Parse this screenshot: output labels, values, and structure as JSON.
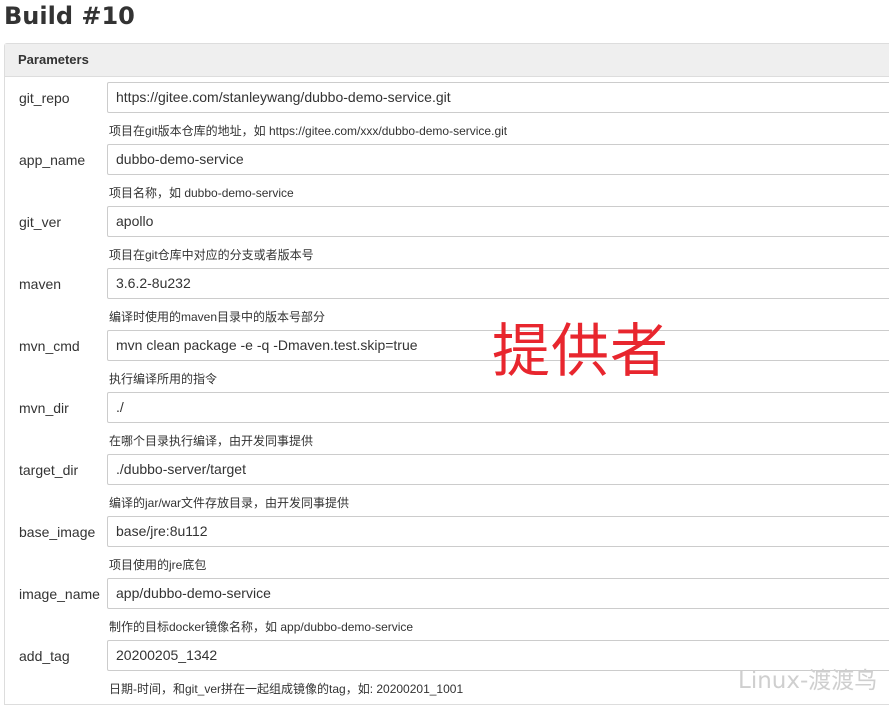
{
  "page": {
    "title": "Build #10"
  },
  "panel": {
    "header": "Parameters"
  },
  "params": [
    {
      "name": "git_repo",
      "value": "https://gitee.com/stanleywang/dubbo-demo-service.git",
      "description": "项目在git版本仓库的地址，如 https://gitee.com/xxx/dubbo-demo-service.git"
    },
    {
      "name": "app_name",
      "value": "dubbo-demo-service",
      "description": "项目名称，如 dubbo-demo-service"
    },
    {
      "name": "git_ver",
      "value": "apollo",
      "description": "项目在git仓库中对应的分支或者版本号"
    },
    {
      "name": "maven",
      "value": "3.6.2-8u232",
      "description": "编译时使用的maven目录中的版本号部分"
    },
    {
      "name": "mvn_cmd",
      "value": "mvn clean package -e -q -Dmaven.test.skip=true",
      "description": "执行编译所用的指令"
    },
    {
      "name": "mvn_dir",
      "value": "./",
      "description": "在哪个目录执行编译，由开发同事提供"
    },
    {
      "name": "target_dir",
      "value": "./dubbo-server/target",
      "description": "编译的jar/war文件存放目录，由开发同事提供"
    },
    {
      "name": "base_image",
      "value": "base/jre:8u112",
      "description": "项目使用的jre底包"
    },
    {
      "name": "image_name",
      "value": "app/dubbo-demo-service",
      "description": "制作的目标docker镜像名称，如 app/dubbo-demo-service"
    },
    {
      "name": "add_tag",
      "value": "20200205_1342",
      "description": "日期-时间，和git_ver拼在一起组成镜像的tag，如: 20200201_1001"
    }
  ],
  "annotation": {
    "text": "提供者",
    "color": "#e8262e"
  },
  "watermark": {
    "text": "Linux-渡渡鸟"
  }
}
